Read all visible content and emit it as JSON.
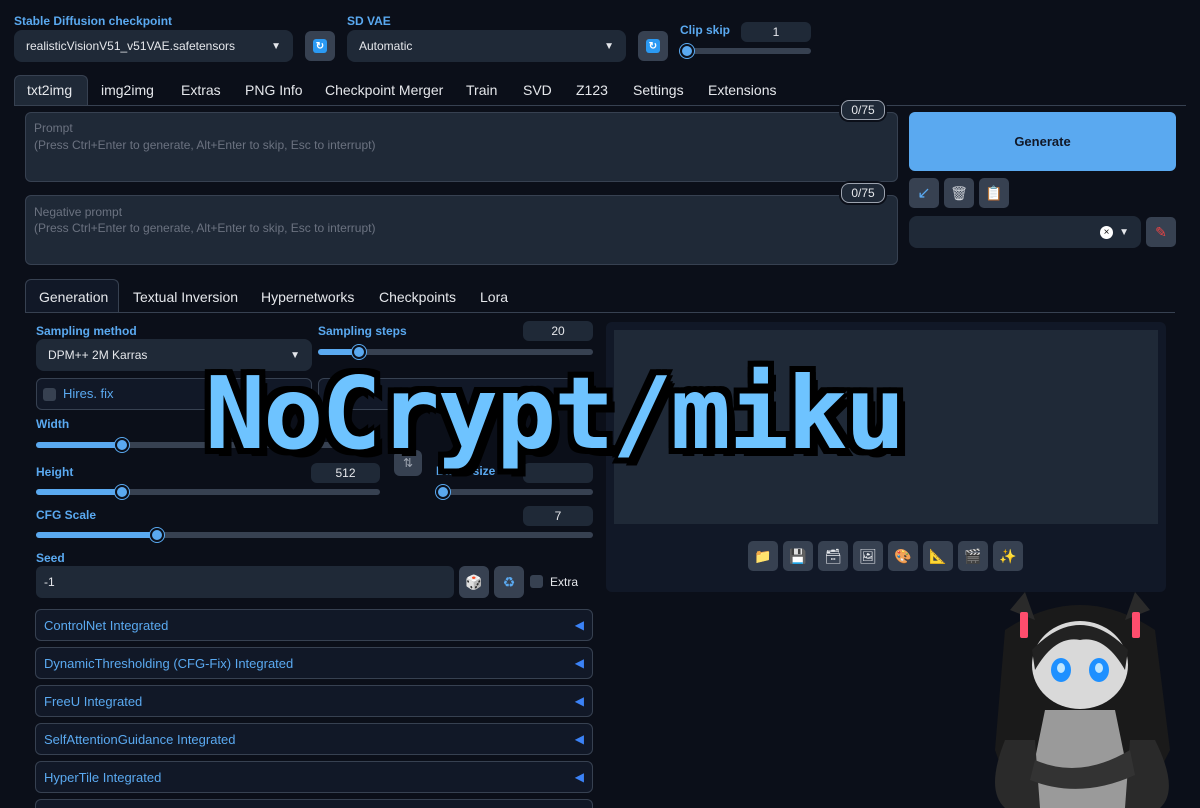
{
  "header": {
    "checkpoint_label": "Stable Diffusion checkpoint",
    "checkpoint_value": "realisticVisionV51_v51VAE.safetensors",
    "vae_label": "SD VAE",
    "vae_value": "Automatic",
    "clip_skip_label": "Clip skip",
    "clip_skip_value": "1",
    "clip_skip_level": 0.0
  },
  "tabs": [
    "txt2img",
    "img2img",
    "Extras",
    "PNG Info",
    "Checkpoint Merger",
    "Train",
    "SVD",
    "Z123",
    "Settings",
    "Extensions"
  ],
  "prompt": {
    "label": "Prompt",
    "hint": "(Press Ctrl+Enter to generate, Alt+Enter to skip, Esc to interrupt)",
    "counter": "0/75"
  },
  "negative_prompt": {
    "label": "Negative prompt",
    "hint": "(Press Ctrl+Enter to generate, Alt+Enter to skip, Esc to interrupt)",
    "counter": "0/75"
  },
  "generate_label": "Generate",
  "subtabs": [
    "Generation",
    "Textual Inversion",
    "Hypernetworks",
    "Checkpoints",
    "Lora"
  ],
  "sampling": {
    "method_label": "Sampling method",
    "method_value": "DPM++ 2M Karras",
    "steps_label": "Sampling steps",
    "steps_value": "20",
    "steps_level": 0.13
  },
  "hires_label": "Hires. fix",
  "width": {
    "label": "Width",
    "level": 0.24
  },
  "height": {
    "label": "Height",
    "value": "512",
    "level": 0.24
  },
  "batch_size_label": "Batch size",
  "cfg": {
    "label": "CFG Scale",
    "value": "7",
    "level": 0.21
  },
  "seed": {
    "label": "Seed",
    "value": "-1",
    "extra_label": "Extra"
  },
  "accordions": [
    "ControlNet Integrated",
    "DynamicThresholding (CFG-Fix) Integrated",
    "FreeU Integrated",
    "SelfAttentionGuidance Integrated",
    "HyperTile Integrated"
  ],
  "watermark": "NoCrypt/miku",
  "colors": {
    "accent": "#5aa9f0",
    "background": "#0b0f19",
    "panel": "#1f2937",
    "generate": "#5aa9f0"
  }
}
